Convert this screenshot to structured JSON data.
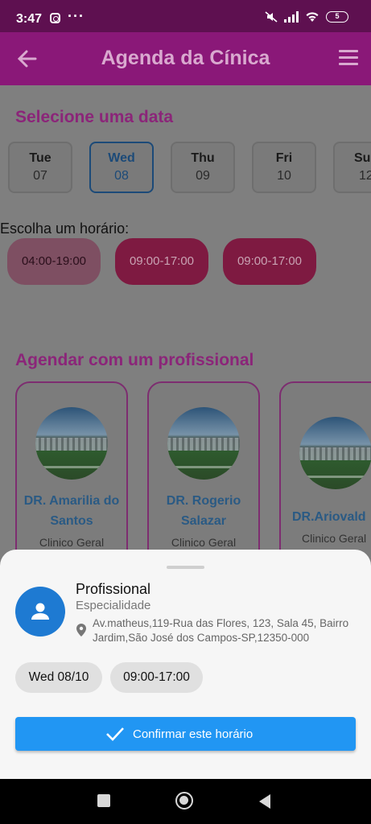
{
  "status_bar": {
    "time": "3:47",
    "battery": "5"
  },
  "app_bar": {
    "title": "Agenda da Cínica"
  },
  "date_section": {
    "title": "Selecione uma data",
    "dates": [
      {
        "day": "Tue",
        "num": "07"
      },
      {
        "day": "Wed",
        "num": "08"
      },
      {
        "day": "Thu",
        "num": "09"
      },
      {
        "day": "Fri",
        "num": "10"
      },
      {
        "day": "Su",
        "num": "12"
      }
    ]
  },
  "hours_section": {
    "label": "Escolha um horário:",
    "slots": [
      "04:00-19:00",
      "09:00-17:00",
      "09:00-17:00"
    ]
  },
  "professionals_section": {
    "title": "Agendar com um profissional",
    "cards": [
      {
        "name": "DR. Amarilia do Santos",
        "spec": "Clinico Geral"
      },
      {
        "name": "DR. Rogerio Salazar",
        "spec": "Clinico Geral"
      },
      {
        "name": "DR.Ariovald",
        "spec": "Clinico Geral"
      }
    ]
  },
  "sheet": {
    "name": "Profissional",
    "specialty": "Especialidade",
    "address": "Av.matheus,119-Rua das Flores, 123, Sala 45, Bairro Jardim,São José dos Campos-SP,12350-000",
    "date_chip": "Wed 08/10",
    "time_chip": "09:00-17:00",
    "confirm_label": "Confirmar este horário"
  },
  "colors": {
    "accent": "#2196f3",
    "app_bar": "#8a1878",
    "status_bar": "#5e1050"
  }
}
